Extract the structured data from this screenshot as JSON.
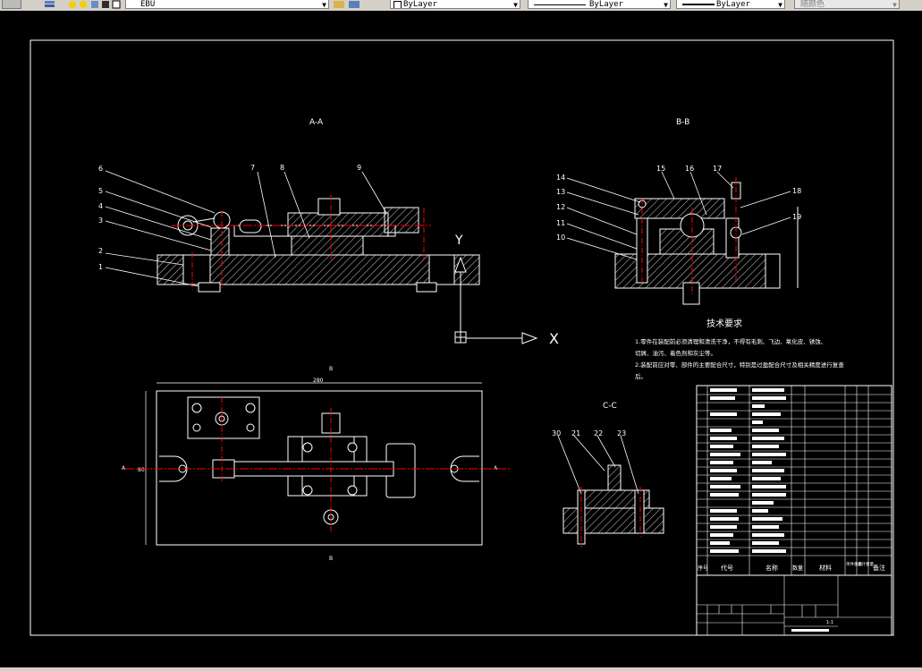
{
  "toolbar": {
    "layer_value": "EBU",
    "color_value": "ByLayer",
    "linetype_value": "ByLayer",
    "lineweight_value": "ByLayer",
    "plotstyle_value": "随颜色"
  },
  "drawing": {
    "section_aa": "A-A",
    "section_bb": "B-B",
    "section_cc": "C-C",
    "aa_balloons": [
      "6",
      "5",
      "4",
      "3",
      "2",
      "1",
      "7",
      "8",
      "9"
    ],
    "bb_balloons": [
      "14",
      "13",
      "12",
      "11",
      "10",
      "15",
      "16",
      "17",
      "18",
      "19"
    ],
    "cc_balloons": [
      "30",
      "21",
      "22",
      "23"
    ],
    "ucs_x": "X",
    "ucs_y": "Y",
    "plan_dim_width": "280",
    "plan_dim_height": "80",
    "plan_cut_a": "A",
    "plan_cut_b": "B",
    "tech_title": "技术要求",
    "tech_lines": [
      "1.零件在装配前必须清理和清洗干净，不得有毛刺、飞边、氧化皮、锈蚀、",
      "切屑、油污、着色剂和灰尘等。",
      "2.装配前应对零、部件的主要配合尺寸，特别是过盈配合尺寸及相关精度进行复查",
      "后。"
    ],
    "bom_header": [
      "序号",
      "代号",
      "名称",
      "数量",
      "材料",
      "单件重量",
      "总计重量",
      "备注"
    ],
    "title_block_scale": "1:1"
  }
}
